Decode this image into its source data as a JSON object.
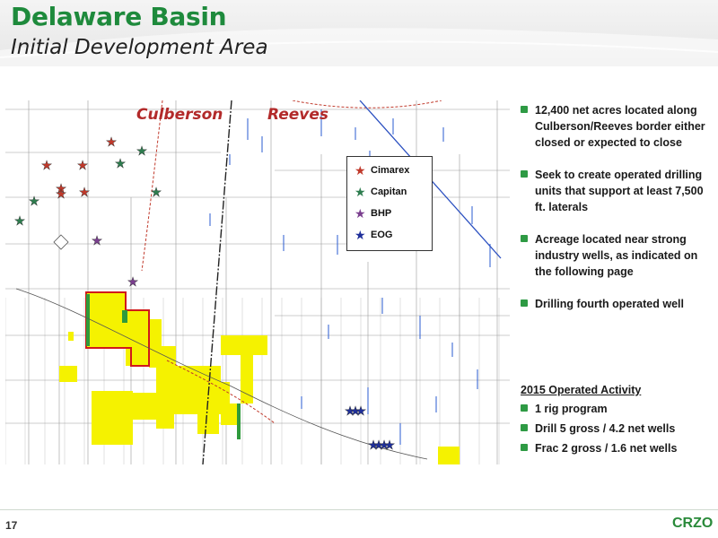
{
  "header": {
    "title": "Delaware Basin",
    "subtitle": "Initial Development Area"
  },
  "map": {
    "county_labels": [
      "Culberson",
      "Reeves"
    ],
    "legend": [
      {
        "label": "Cimarex",
        "color": "#c0392b"
      },
      {
        "label": "Capitan",
        "color": "#2e7d4f"
      },
      {
        "label": "BHP",
        "color": "#7a3e8e"
      },
      {
        "label": "EOG",
        "color": "#1f2f9a"
      }
    ],
    "colors": {
      "acreage_fill": "#f5f200",
      "acreage_border": "#d11a1a",
      "owned_strip": "#2f9a3c",
      "county_line": "#333333",
      "road": "#c0392b",
      "wells": "#2a5bd0",
      "grid": "#8a8a8a"
    }
  },
  "bullets": [
    "12,400 net acres located along Culberson/Reeves border either closed or expected to close",
    "Seek to create operated drilling units that support at least 7,500 ft. laterals",
    "Acreage located near strong industry wells, as indicated on the following page",
    "Drilling fourth operated well"
  ],
  "activity": {
    "title": "2015 Operated Activity",
    "items": [
      "1 rig program",
      "Drill 5 gross / 4.2 net wells",
      "Frac 2 gross / 1.6 net wells"
    ]
  },
  "footer": {
    "page_number": "17",
    "logo": "CRZO"
  }
}
